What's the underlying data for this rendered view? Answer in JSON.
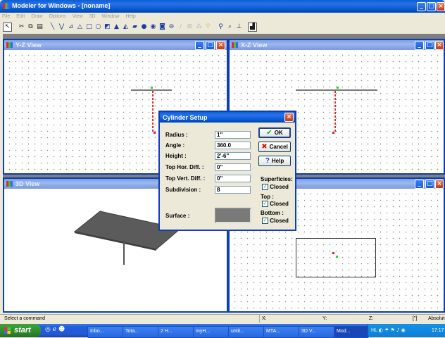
{
  "app": {
    "title": "Modeler for Windows - [noname]"
  },
  "menu": [
    "File",
    "Edit",
    "Draw",
    "Options",
    "View",
    "3D",
    "Window",
    "Help"
  ],
  "toolbar_icons": [
    "select-arrow-icon",
    "cut-icon",
    "copy-icon",
    "paste-icon",
    "line-icon",
    "polyline-icon",
    "polygon-icon",
    "triangle-icon",
    "rectangle-icon",
    "circle-icon",
    "cube-icon",
    "pyramid-icon",
    "prism-icon",
    "box-icon",
    "sphere-icon",
    "torus-icon",
    "cylinder-icon",
    "cone-icon",
    "measure-icon",
    "grid-icon",
    "snap-icon",
    "light-icon",
    "zoom-icon",
    "zoom-fit-icon",
    "axis-icon",
    "chart-icon"
  ],
  "views": {
    "yz": {
      "title": "Y-Z View"
    },
    "xz": {
      "title": "X-Z View"
    },
    "v3d": {
      "title": "3D View"
    }
  },
  "dialog": {
    "title": "Cylinder Setup",
    "fields": [
      {
        "label": "Radius :",
        "value": "1\""
      },
      {
        "label": "Angle :",
        "value": "360.0"
      },
      {
        "label": "Height :",
        "value": "2'-6\""
      },
      {
        "label": "Top Hor. Diff. :",
        "value": "0\""
      },
      {
        "label": "Top Vert. Diff. :",
        "value": "0\""
      },
      {
        "label": "Subdivision :",
        "value": "8"
      }
    ],
    "surface_label": "Surface :",
    "surface_color": "#7a7a7a",
    "ok_label": "OK",
    "cancel_label": "Cancel",
    "help_label": "Help",
    "superficies_label": "Superficies:",
    "top_label": "Top :",
    "bottom_label": "Bottom :",
    "closed_label": "Closed"
  },
  "status": {
    "message": "Select a command",
    "x": "X:",
    "y": "Y:",
    "z": "Z:",
    "unit": "[\"]",
    "mode": "Absolut"
  },
  "taskbar": {
    "start": "start",
    "buttons": [
      "Inbo...",
      "Tota...",
      "2 H...",
      "myH...",
      "untit...",
      "MTA...",
      "3D V...",
      "Mod..."
    ],
    "tray_lang": "HL",
    "clock": "17:17"
  }
}
